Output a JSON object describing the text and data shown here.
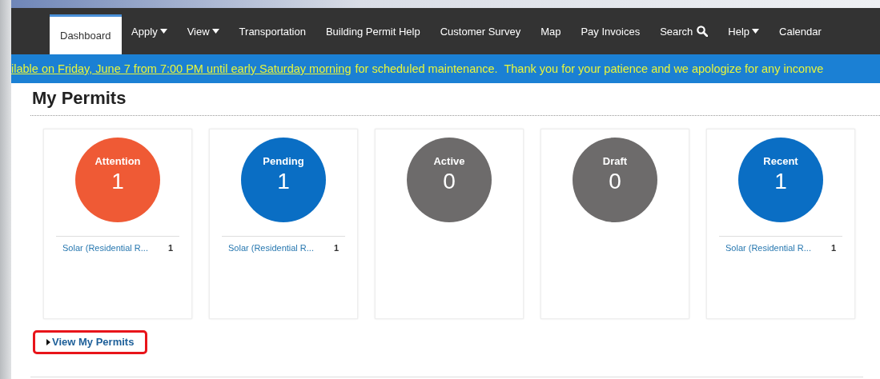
{
  "nav": [
    {
      "label": "Dashboard",
      "kind": "link",
      "selected": true
    },
    {
      "label": "Apply",
      "kind": "menu",
      "selected": false
    },
    {
      "label": "View",
      "kind": "menu",
      "selected": false
    },
    {
      "label": "Transportation",
      "kind": "link",
      "selected": false
    },
    {
      "label": "Building Permit Help",
      "kind": "link",
      "selected": false
    },
    {
      "label": "Customer Survey",
      "kind": "link",
      "selected": false
    },
    {
      "label": "Map",
      "kind": "link",
      "selected": false
    },
    {
      "label": "Pay Invoices",
      "kind": "link",
      "selected": false
    },
    {
      "label": "Search",
      "kind": "search",
      "selected": false
    },
    {
      "label": "Help",
      "kind": "menu",
      "selected": false
    },
    {
      "label": "Calendar",
      "kind": "link",
      "selected": false
    }
  ],
  "banner": {
    "link": "ilable on Friday, June 7 from 7:00 PM until early Saturday morning",
    "text": "for scheduled maintenance.  Thank you for your patience and we apologize for any inconve"
  },
  "heading": "My Permits",
  "cards": [
    {
      "label": "Attention",
      "count": "1",
      "color": "#ef5a35",
      "items": [
        {
          "name": "Solar (Residential R...",
          "count": "1"
        }
      ]
    },
    {
      "label": "Pending",
      "count": "1",
      "color": "#0a6ec4",
      "items": [
        {
          "name": "Solar (Residential R...",
          "count": "1"
        }
      ]
    },
    {
      "label": "Active",
      "count": "0",
      "color": "#6d6b6b"
    },
    {
      "label": "Draft",
      "count": "0",
      "color": "#6d6b6b"
    },
    {
      "label": "Recent",
      "count": "1",
      "color": "#0a6ec4",
      "items": [
        {
          "name": "Solar (Residential R...",
          "count": "1"
        }
      ]
    }
  ],
  "view_link": "View My Permits"
}
